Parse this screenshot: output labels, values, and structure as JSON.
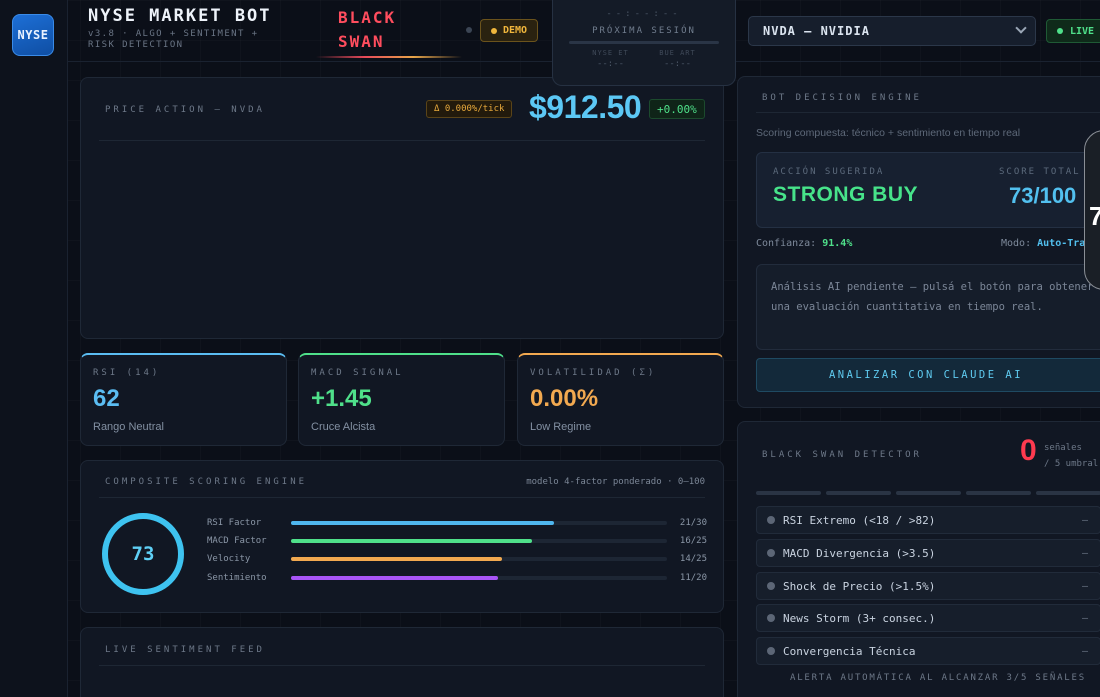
{
  "app": {
    "logo": "NYSE",
    "title": "NYSE MARKET BOT",
    "subtitle": "v3.8 · ALGO + SENTIMENT + RISK DETECTION",
    "black_swan_line1": "BLACK",
    "black_swan_line2": "SWAN",
    "demo_label": "DEMO",
    "live_label": "LIVE"
  },
  "session": {
    "clock": "--:--:--",
    "label": "PRÓXIMA SESIÓN",
    "market_1": "NYSE ET",
    "market_2": "BUE ART",
    "time_1": "--:--",
    "time_2": "--:--"
  },
  "ticker": {
    "selected": "NVDA — NVIDIA"
  },
  "price_panel": {
    "title": "PRICE ACTION — NVDA",
    "tick": "Δ 0.000%/tick",
    "price": "$912.50",
    "change": "+0.00%"
  },
  "metrics": [
    {
      "label": "RSI (14)",
      "value": "62",
      "sub": "Rango Neutral",
      "color": "#5bbdf2"
    },
    {
      "label": "MACD SIGNAL",
      "value": "+1.45",
      "sub": "Cruce Alcista",
      "color": "#4fe08a"
    },
    {
      "label": "VOLATILIDAD (Σ)",
      "value": "0.00%",
      "sub": "Low Regime",
      "color": "#f2a950"
    }
  ],
  "scoring": {
    "title": "COMPOSITE SCORING ENGINE",
    "model": "modelo 4-factor ponderado · 0–100",
    "total": "73",
    "factors": [
      {
        "name": "RSI Factor",
        "score": "21/30",
        "pct": 0.7,
        "color": "#4fb6ee"
      },
      {
        "name": "MACD Factor",
        "score": "16/25",
        "pct": 0.64,
        "color": "#4fe08a"
      },
      {
        "name": "Velocity",
        "score": "14/25",
        "pct": 0.56,
        "color": "#f2a950"
      },
      {
        "name": "Sentimiento",
        "score": "11/20",
        "pct": 0.55,
        "color": "#a855f7"
      }
    ]
  },
  "feed": {
    "title": "LIVE SENTIMENT FEED"
  },
  "engine": {
    "title": "BOT DECISION ENGINE",
    "description": "Scoring compuesta: técnico + sentimiento en tiempo real",
    "action_label": "ACCIÓN SUGERIDA",
    "action": "STRONG BUY",
    "score_label": "SCORE TOTAL",
    "score": "73/100",
    "confidence_label": "Confianza:",
    "confidence": "91.4%",
    "mode_label": "Modo:",
    "mode": "Auto-Tra",
    "ai_text": "Análisis AI pendiente — pulsá el botón para obtener una evaluación cuantitativa en tiempo real.",
    "button": "ANALIZAR CON CLAUDE AI"
  },
  "overlay": {
    "glyph": "7"
  },
  "black_swan": {
    "title": "BLACK SWAN DETECTOR",
    "count": "0",
    "count_label_1": "señales",
    "count_label_2": "/ 5 umbral",
    "signals": [
      {
        "label": "RSI Extremo (<18 / >82)",
        "status": "—"
      },
      {
        "label": "MACD Divergencia (>3.5)",
        "status": "—"
      },
      {
        "label": "Shock de Precio (>1.5%)",
        "status": "—"
      },
      {
        "label": "News Storm (3+ consec.)",
        "status": "—"
      },
      {
        "label": "Convergencia Técnica",
        "status": "—"
      }
    ],
    "footer": "ALERTA AUTOMÁTICA AL ALCANZAR 3/5 SEÑALES"
  }
}
